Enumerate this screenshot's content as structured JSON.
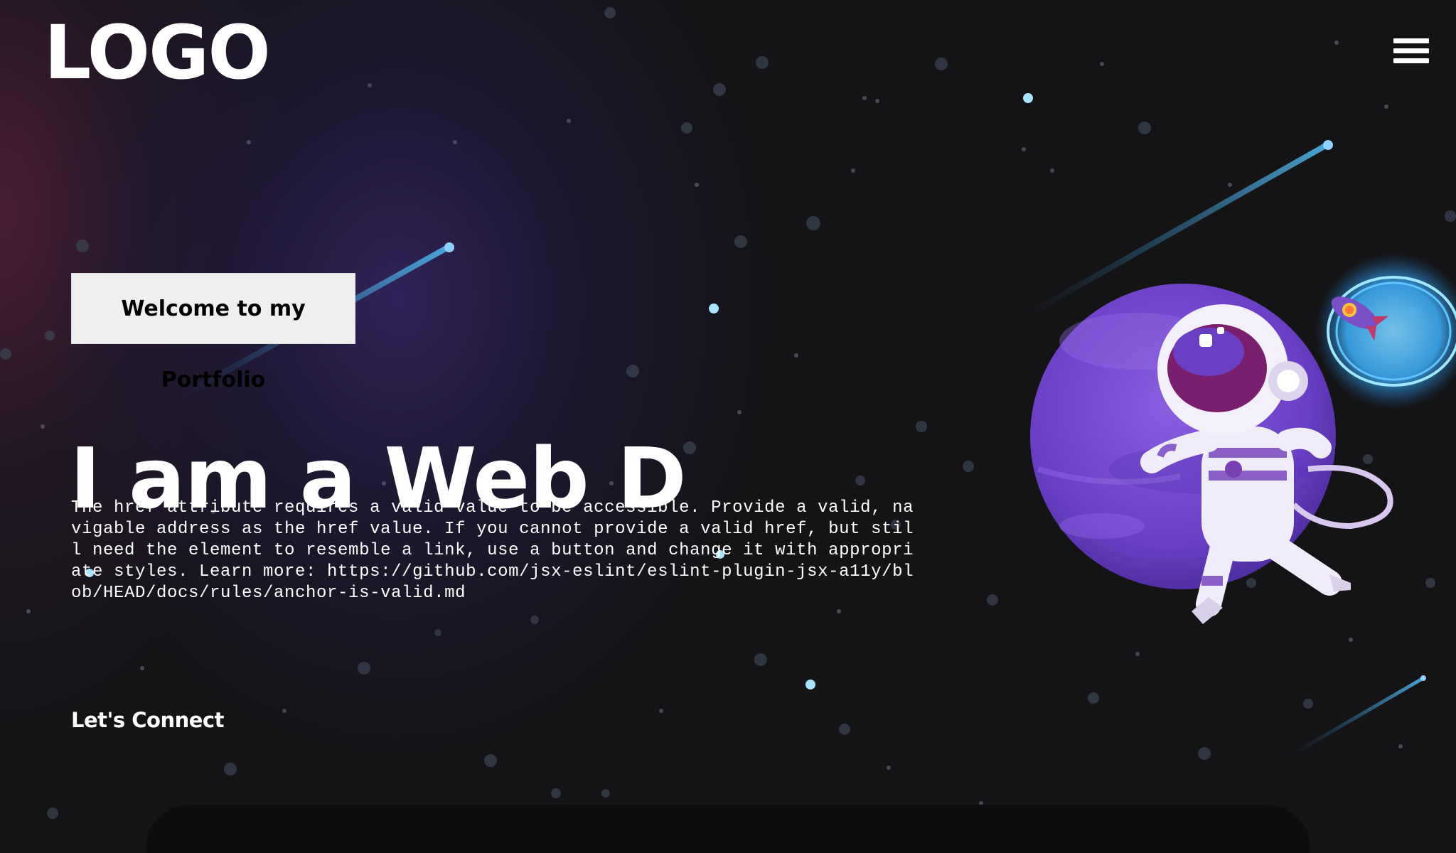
{
  "header": {
    "logo_text": "LOGO",
    "menu_icon": "hamburger-menu-icon"
  },
  "hero": {
    "tagline": "Welcome to my Portfolio",
    "headline": "I am a Web D",
    "description": "The href attribute requires a valid value to be accessible. Provide a valid, navigable address as the href value. If you cannot provide a valid href, but still need the element to resemble a link, use a button and change it with appropriate styles. Learn more: https://github.com/jsx-eslint/eslint-plugin-jsx-a11y/blob/HEAD/docs/rules/anchor-is-valid.md",
    "connect_label": "Let's Connect"
  },
  "colors": {
    "background": "#141417",
    "text": "#ffffff",
    "tagline_bg": "#efefef",
    "planet": "#7a4fd0",
    "portal": "#3fb6ff"
  }
}
